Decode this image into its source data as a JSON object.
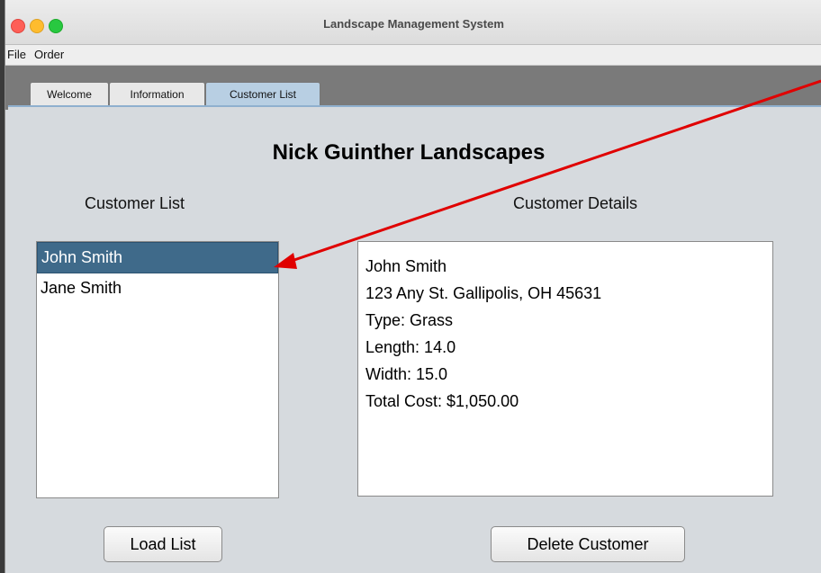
{
  "window": {
    "title": "Landscape Management System"
  },
  "menu": [
    "File",
    "Order"
  ],
  "tabs": [
    "Welcome",
    "Information",
    "Customer List"
  ],
  "active_tab": "Customer List",
  "heading": "Nick Guinther Landscapes",
  "customer_list": {
    "label": "Customer List",
    "items": [
      "John Smith",
      "Jane Smith"
    ],
    "selected": "John Smith"
  },
  "customer_details": {
    "label": "Customer Details",
    "lines": [
      "John Smith",
      "123 Any St. Gallipolis, OH 45631",
      "Type: Grass",
      "Length: 14.0",
      "Width: 15.0",
      "Total Cost: $1,050.00"
    ]
  },
  "buttons": {
    "load": "Load List",
    "delete": "Delete Customer"
  },
  "colors": {
    "selection": "#3f6a8a",
    "annotation_arrow": "#e00000",
    "active_tab": "#b8cfe3"
  }
}
